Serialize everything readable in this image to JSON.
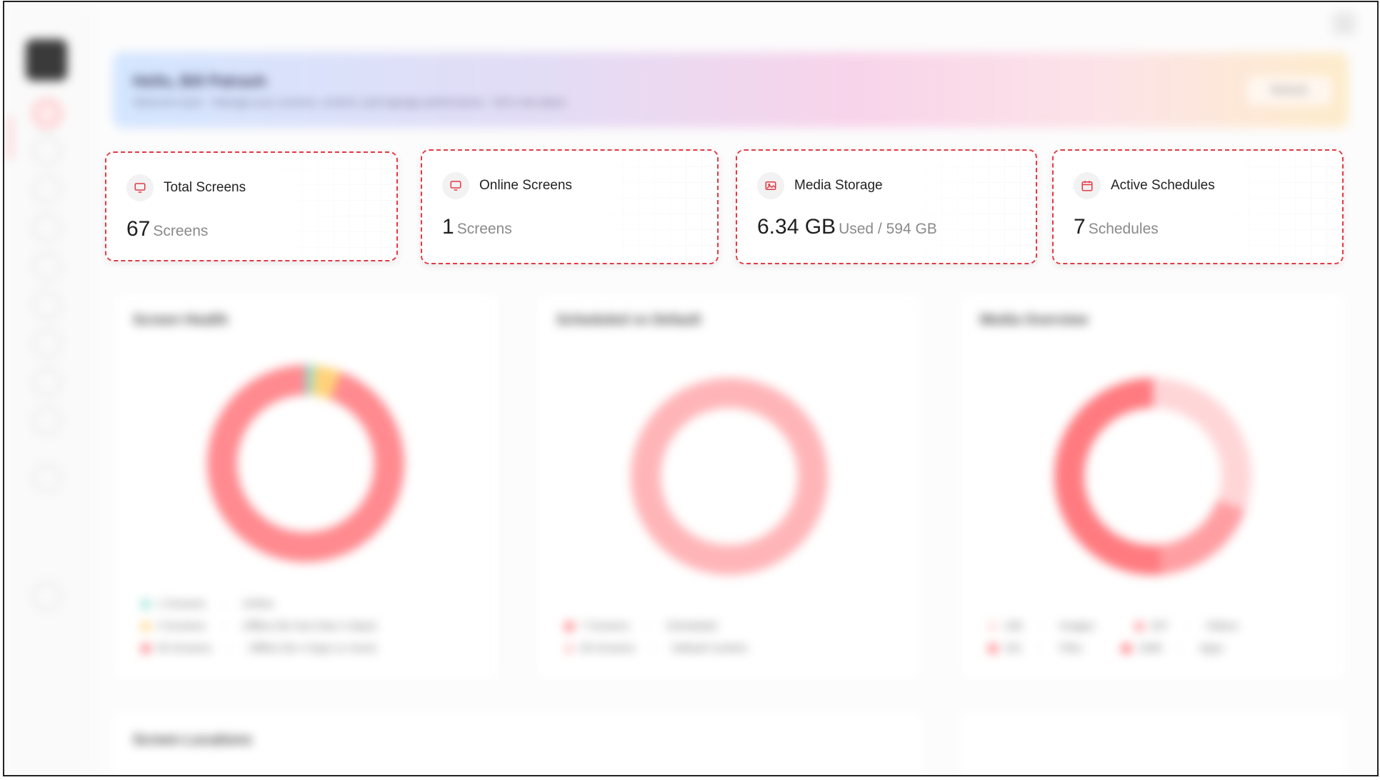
{
  "banner": {
    "title": "Hello, Bill Patrash",
    "subtitle": "Welcome back · Manage your screens, content, and signage performance · All in one place",
    "refresh_label": "Refresh"
  },
  "stats": [
    {
      "label": "Total Screens",
      "value": "67",
      "unit": "Screens",
      "icon": "monitor-icon"
    },
    {
      "label": "Online Screens",
      "value": "1",
      "unit": "Screens",
      "icon": "monitor-icon"
    },
    {
      "label": "Media Storage",
      "value": "6.34 GB",
      "unit": "Used / 594 GB",
      "icon": "image-icon"
    },
    {
      "label": "Active Schedules",
      "value": "7",
      "unit": "Schedules",
      "icon": "calendar-icon"
    }
  ],
  "panels": {
    "screen_health": {
      "title": "Screen Health",
      "legend": [
        {
          "count": "1 Screens",
          "label": "Online",
          "color": "#8ee0d4"
        },
        {
          "count": "3 Screens",
          "label": "Offline (for less than 4 days)",
          "color": "#ffd27a"
        },
        {
          "count": "63 Screens",
          "label": "Offline (for 4 days or more)",
          "color": "#ff6f76"
        }
      ]
    },
    "scheduled_vs_default": {
      "title": "Scheduled vs Default",
      "legend": [
        {
          "count": "7 Screens",
          "label": "Scheduled",
          "color": "#ff6f76"
        },
        {
          "count": "60 Screens",
          "label": "Default Content",
          "color": "#ffc2c4"
        }
      ]
    },
    "media_overview": {
      "title": "Media Overview",
      "legend": [
        {
          "count": "158",
          "label": "Images",
          "color": "#ffd6d8"
        },
        {
          "count": "207",
          "label": "Videos",
          "color": "#ff8f94"
        },
        {
          "count": "161",
          "label": "Files",
          "color": "#ff6f76"
        },
        {
          "count": "1066",
          "label": "Apps",
          "color": "#ff5b63"
        }
      ]
    }
  },
  "bottom": {
    "locations_title": "Screen Locations"
  },
  "colors": {
    "accent": "#e23a44",
    "donut_main": "#ff8a8f"
  }
}
